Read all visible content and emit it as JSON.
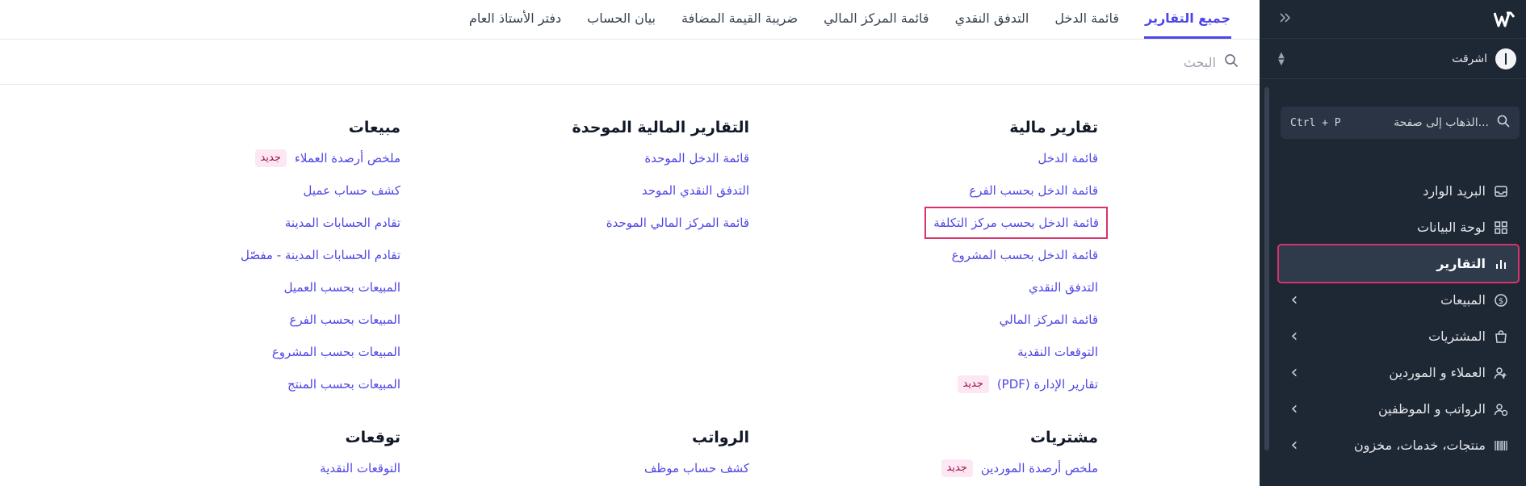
{
  "colors": {
    "sidebar_bg": "#1e2734",
    "accent": "#4f46e5",
    "highlight_border": "#d9336b",
    "badge_bg": "#fce7f3",
    "badge_text": "#9d174d"
  },
  "sidebar": {
    "logo_icon": "w-logo-icon",
    "collapse_icon": "double-chevron-right-icon",
    "org": {
      "name": "اشرقت",
      "switch_icon": "chevron-up-down-icon"
    },
    "search": {
      "placeholder": "الذهاب إلى صفحة...",
      "shortcut": "Ctrl + P",
      "icon": "search-icon"
    },
    "items": [
      {
        "label": "البريد الوارد",
        "icon": "inbox-icon",
        "has_chevron": false,
        "active": false
      },
      {
        "label": "لوحة البيانات",
        "icon": "dashboard-icon",
        "has_chevron": false,
        "active": false
      },
      {
        "label": "التقارير",
        "icon": "bar-chart-icon",
        "has_chevron": false,
        "active": true
      },
      {
        "label": "المبيعات",
        "icon": "dollar-icon",
        "has_chevron": true,
        "active": false
      },
      {
        "label": "المشتريات",
        "icon": "shopping-bag-icon",
        "has_chevron": true,
        "active": false
      },
      {
        "label": "العملاء و الموردين",
        "icon": "users-icon",
        "has_chevron": true,
        "active": false
      },
      {
        "label": "الرواتب و الموظفين",
        "icon": "employee-icon",
        "has_chevron": true,
        "active": false
      },
      {
        "label": "منتجات، خدمات، مخزون",
        "icon": "barcode-icon",
        "has_chevron": true,
        "active": false
      }
    ]
  },
  "tabs": [
    {
      "label": "جميع التقارير",
      "active": true
    },
    {
      "label": "قائمة الدخل",
      "active": false
    },
    {
      "label": "التدفق النقدي",
      "active": false
    },
    {
      "label": "قائمة المركز المالي",
      "active": false
    },
    {
      "label": "ضريبة القيمة المضافة",
      "active": false
    },
    {
      "label": "بيان الحساب",
      "active": false
    },
    {
      "label": "دفتر الأستاذ العام",
      "active": false
    }
  ],
  "main_search": {
    "placeholder": "البحث",
    "icon": "search-icon"
  },
  "new_badge": "جديد",
  "columns": [
    {
      "sections": [
        {
          "title": "تقارير مالية",
          "links": [
            {
              "label": "قائمة الدخل"
            },
            {
              "label": "قائمة الدخل بحسب الفرع"
            },
            {
              "label": "قائمة الدخل بحسب مركز التكلفة",
              "highlight": true
            },
            {
              "label": "قائمة الدخل بحسب المشروع"
            },
            {
              "label": "التدفق النقدي"
            },
            {
              "label": "قائمة المركز المالي"
            },
            {
              "label": "التوقعات النقدية"
            },
            {
              "label": "تقارير الإدارة (PDF)",
              "badge": true
            }
          ]
        },
        {
          "title": "مشتريات",
          "links": [
            {
              "label": "ملخص أرصدة الموردين",
              "badge": true
            }
          ]
        }
      ]
    },
    {
      "sections": [
        {
          "title": "التقارير المالية الموحدة",
          "links": [
            {
              "label": "قائمة الدخل الموحدة"
            },
            {
              "label": "التدفق النقدي الموحد"
            },
            {
              "label": "قائمة المركز المالي الموحدة"
            }
          ],
          "pad_rows": 5
        },
        {
          "title": "الرواتب",
          "links": [
            {
              "label": "كشف حساب موظف"
            }
          ]
        }
      ]
    },
    {
      "sections": [
        {
          "title": "مبيعات",
          "links": [
            {
              "label": "ملخص أرصدة العملاء",
              "badge": true
            },
            {
              "label": "كشف حساب عميل"
            },
            {
              "label": "تقادم الحسابات المدينة"
            },
            {
              "label": "تقادم الحسابات المدينة - مفصّل"
            },
            {
              "label": "المبيعات بحسب العميل"
            },
            {
              "label": "المبيعات بحسب الفرع"
            },
            {
              "label": "المبيعات بحسب المشروع"
            },
            {
              "label": "المبيعات بحسب المنتج"
            }
          ]
        },
        {
          "title": "توقعات",
          "links": [
            {
              "label": "التوقعات النقدية"
            }
          ]
        }
      ]
    }
  ]
}
